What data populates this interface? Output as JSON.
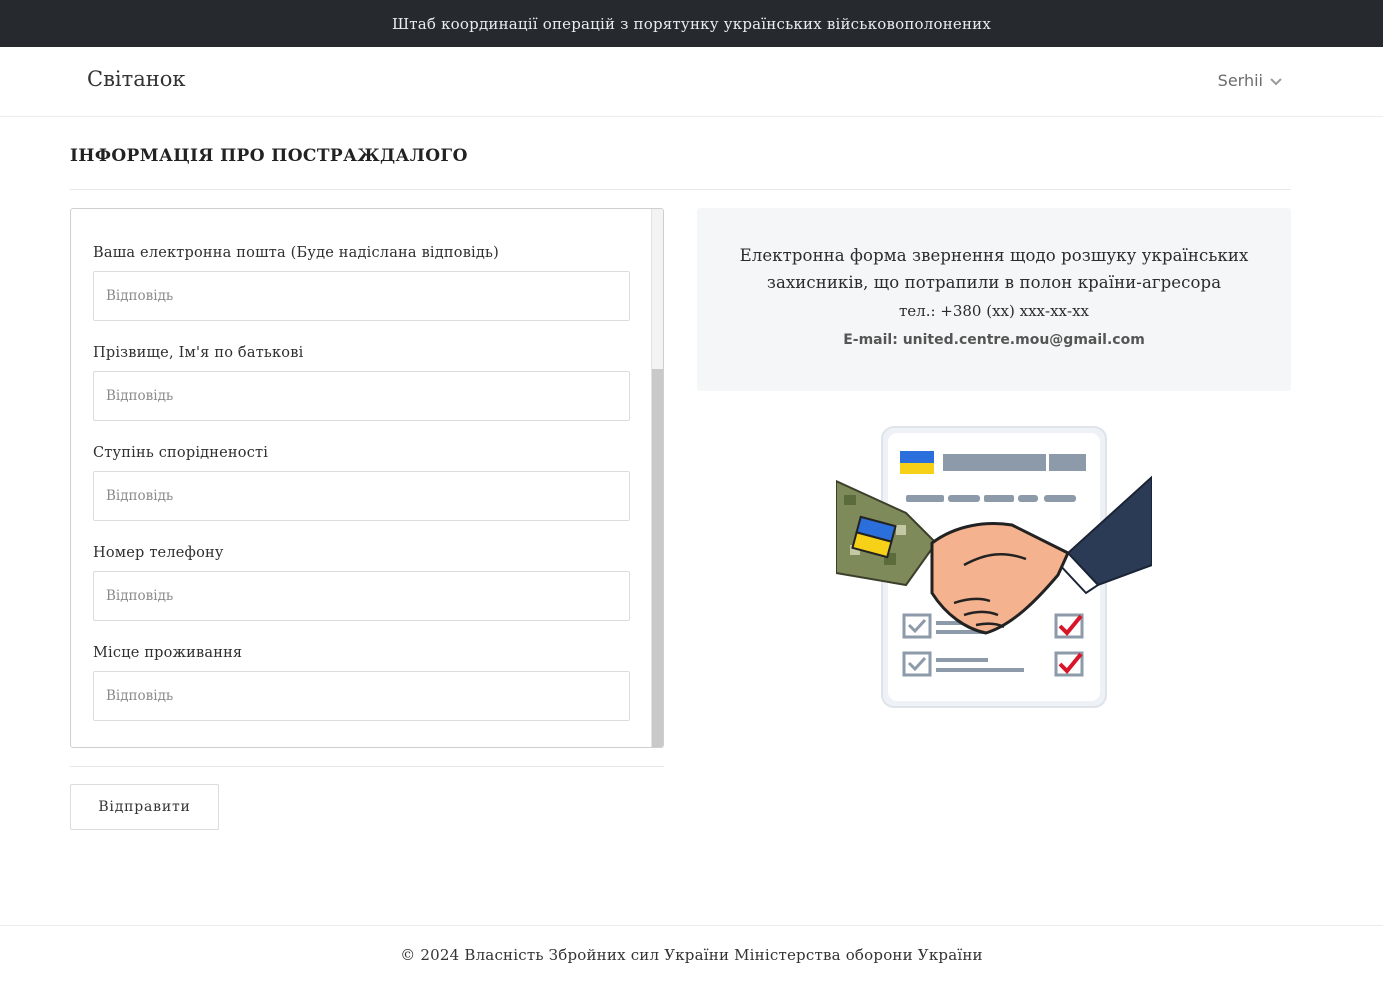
{
  "topbar": {
    "text": "Штаб координації операцій з порятунку українських військовополонених"
  },
  "navbar": {
    "brand": "Світанок",
    "user_name": "Serhii",
    "user_icon": "chevron-down-icon"
  },
  "page": {
    "title": "ІНФОРМАЦІЯ ПРО ПОСТРАЖДАЛОГО"
  },
  "form": {
    "fields": [
      {
        "label": "Ваша електронна пошта (Буде надіслана відповідь)",
        "placeholder": "Відповідь",
        "value": ""
      },
      {
        "label": "Прізвище, Ім'я по батькові",
        "placeholder": "Відповідь",
        "value": ""
      },
      {
        "label": "Ступінь спорідненості",
        "placeholder": "Відповідь",
        "value": ""
      },
      {
        "label": "Номер телефону",
        "placeholder": "Відповідь",
        "value": ""
      },
      {
        "label": "Місце проживання",
        "placeholder": "Відповідь",
        "value": ""
      }
    ],
    "submit_label": "Відправити"
  },
  "info": {
    "description": "Електронна форма звернення щодо розшуку українських захисників, що потрапили в полон країни-агресора",
    "phone": "тел.: +380 (хх) ххх-хх-хх",
    "email": "E-mail: united.centre.mou@gmail.com"
  },
  "illustration": {
    "icon": "handshake-document-illustration"
  },
  "colors": {
    "topbar_bg": "#262a2e",
    "flag_blue": "#2a6fdb",
    "flag_yellow": "#f7d117",
    "check_red": "#d9152a"
  },
  "footer": {
    "text": "© 2024 Власність Збройних сил України Міністерства оборони України"
  }
}
